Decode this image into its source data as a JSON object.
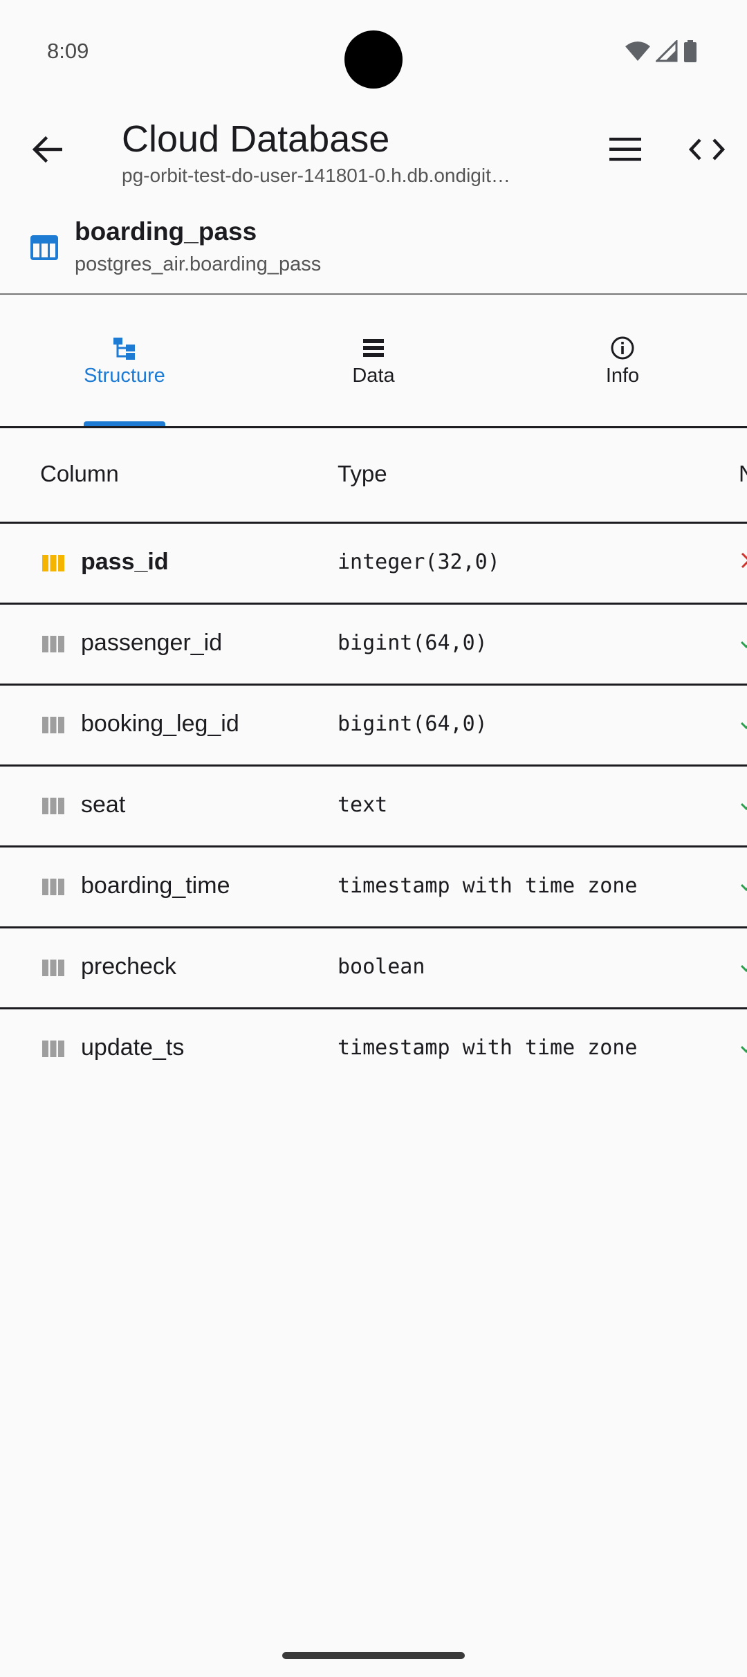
{
  "status_bar": {
    "time": "8:09"
  },
  "app_bar": {
    "title": "Cloud Database",
    "subtitle": "pg-orbit-test-do-user-141801-0.h.db.ondigit…",
    "icons": {
      "back": "arrow-left-icon",
      "menu": "hamburger-menu-icon",
      "code": "code-icon"
    }
  },
  "table_header": {
    "icon": "table-icon",
    "name": "boarding_pass",
    "path": "postgres_air.boarding_pass"
  },
  "tabs": [
    {
      "label": "Structure",
      "icon": "structure-icon",
      "active": true
    },
    {
      "label": "Data",
      "icon": "data-icon",
      "active": false
    },
    {
      "label": "Info",
      "icon": "info-icon",
      "active": false
    }
  ],
  "columns_header": {
    "column": "Column",
    "type": "Type",
    "nullable": "N"
  },
  "columns": [
    {
      "name": "pass_id",
      "type": "integer(32,0)",
      "primary_key": true,
      "nullable": false
    },
    {
      "name": "passenger_id",
      "type": "bigint(64,0)",
      "primary_key": false,
      "nullable": true
    },
    {
      "name": "booking_leg_id",
      "type": "bigint(64,0)",
      "primary_key": false,
      "nullable": true
    },
    {
      "name": "seat",
      "type": "text",
      "primary_key": false,
      "nullable": true
    },
    {
      "name": "boarding_time",
      "type": "timestamp with time zone",
      "primary_key": false,
      "nullable": true
    },
    {
      "name": "precheck",
      "type": "boolean",
      "primary_key": false,
      "nullable": true
    },
    {
      "name": "update_ts",
      "type": "timestamp with time zone",
      "primary_key": false,
      "nullable": true
    }
  ],
  "colors": {
    "accent": "#1e7bd4",
    "primary_key": "#f5b400",
    "column_icon": "#9e9e9e",
    "nullable_check": "#2e9e4f",
    "not_null_cross": "#d0342c"
  }
}
